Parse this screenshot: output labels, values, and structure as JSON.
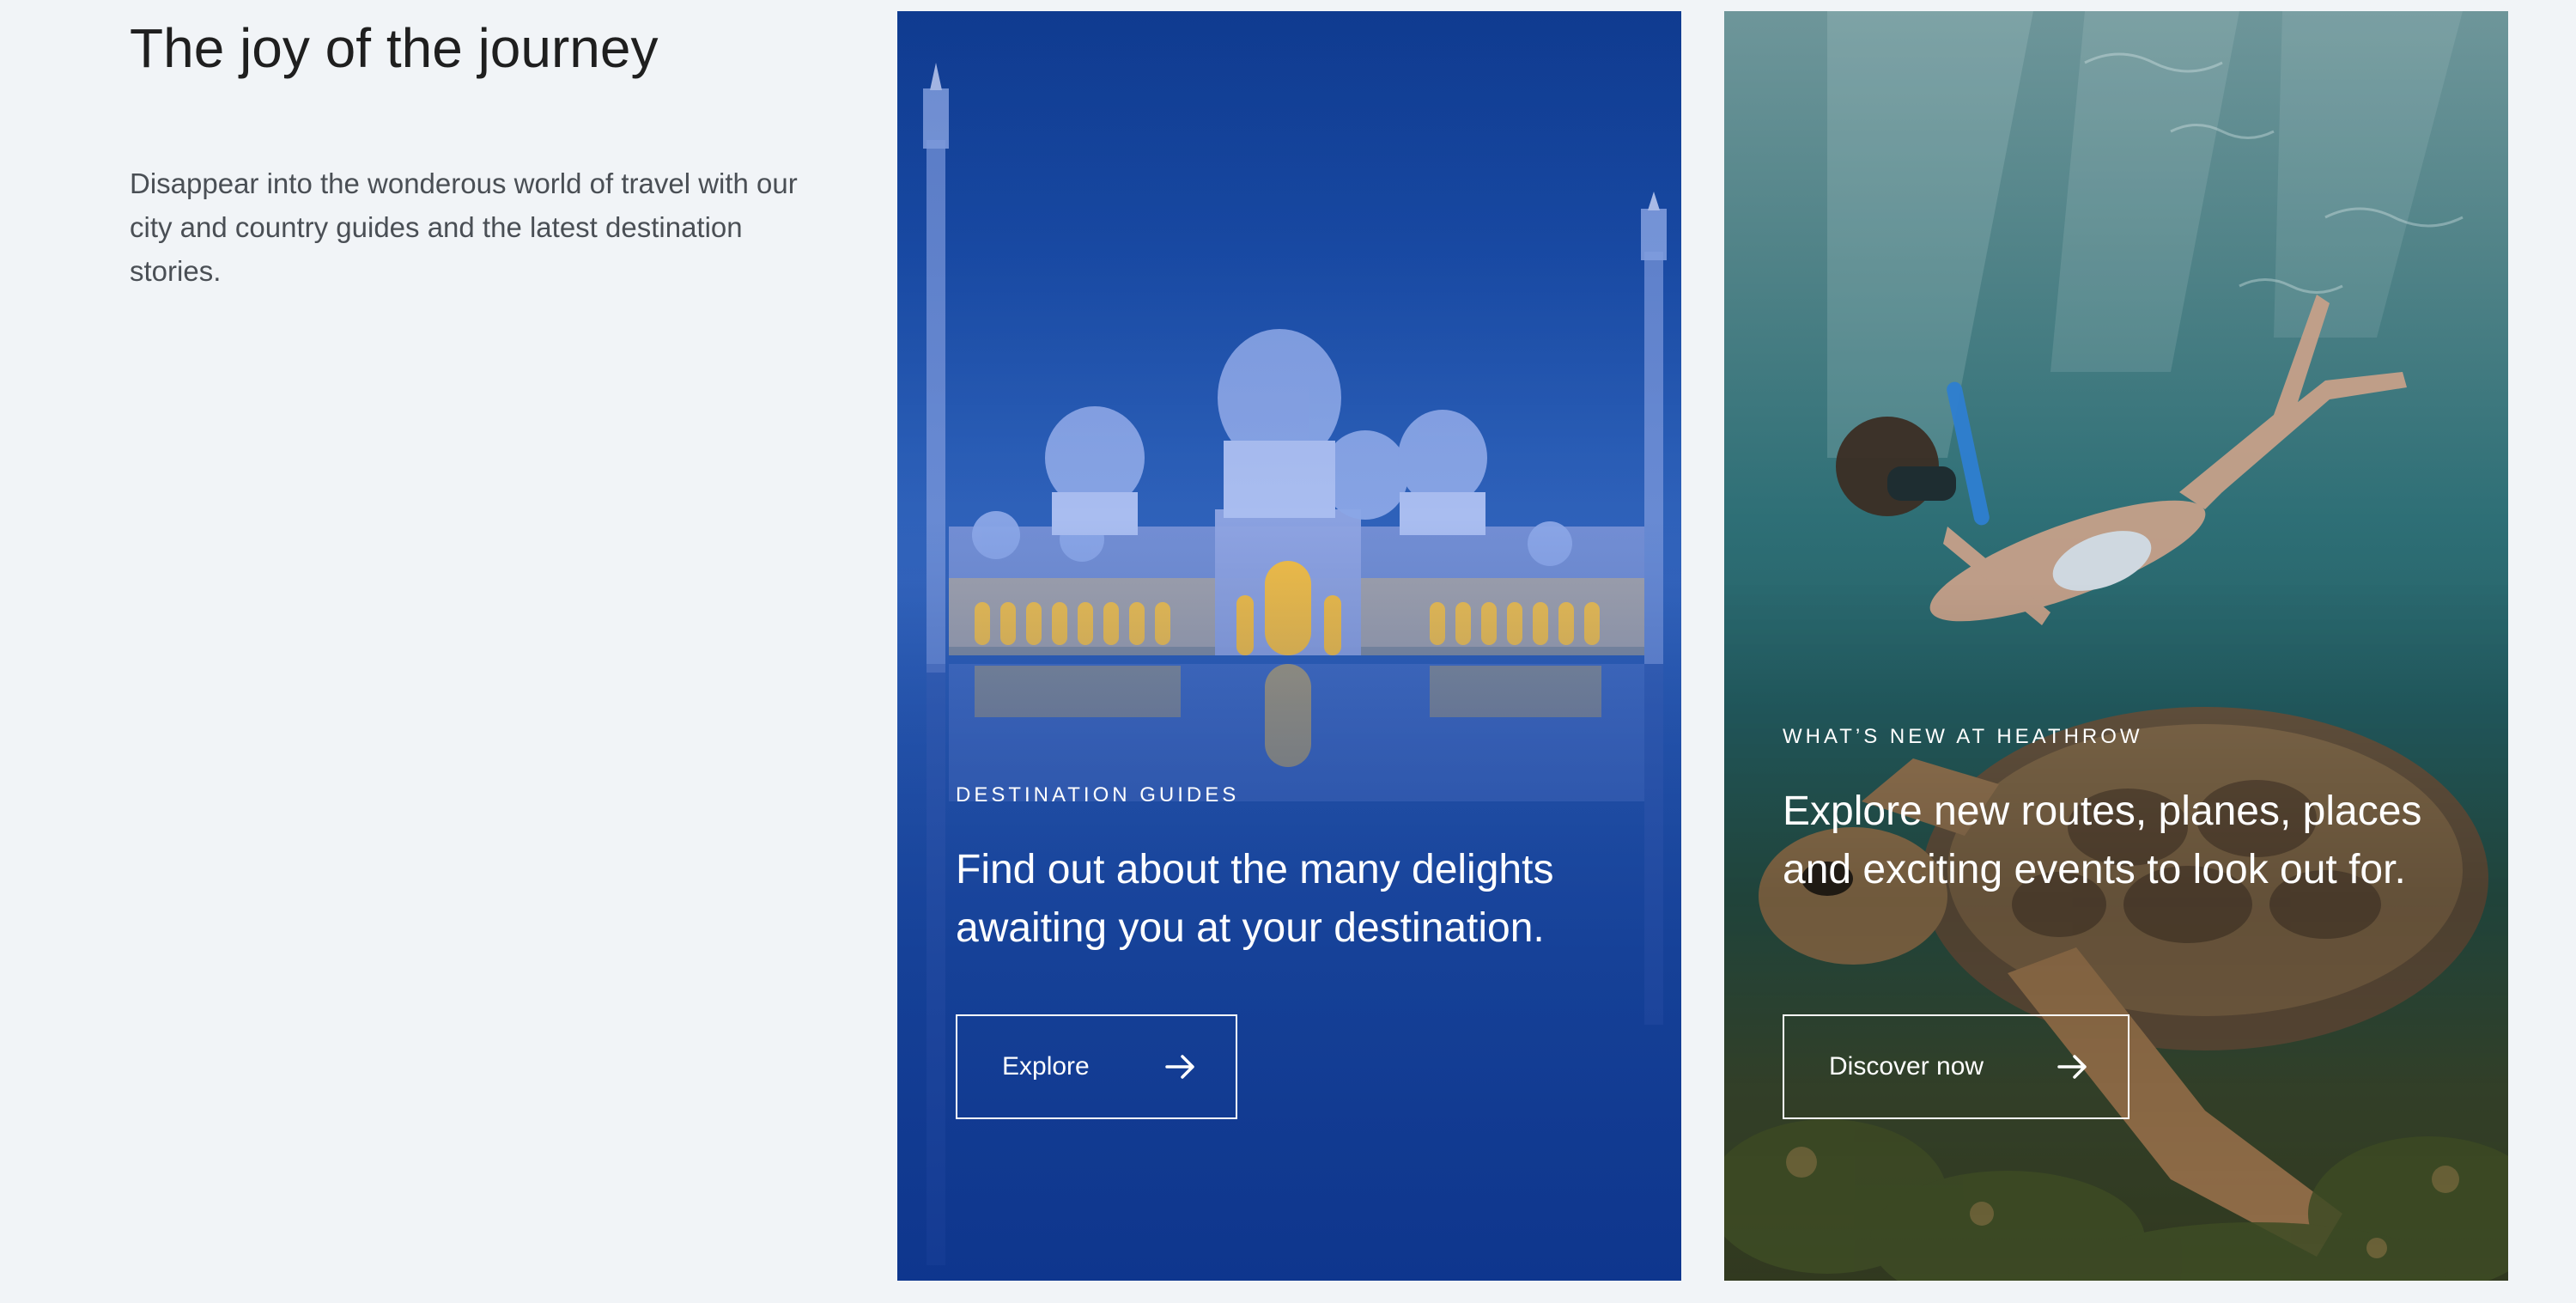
{
  "intro": {
    "title": "The joy of the journey",
    "description": "Disappear into the wonderous world of travel with our city and country guides and the latest destination stories."
  },
  "cards": [
    {
      "eyebrow": "DESTINATION GUIDES",
      "headline": "Find out about the many delights awaiting you at your destination.",
      "cta_label": "Explore",
      "cta_icon": "arrow-right-icon",
      "image": "mosque-reflection-image"
    },
    {
      "eyebrow": "WHAT’S NEW AT HEATHROW",
      "headline": "Explore new routes, planes, places and exciting events to look out for.",
      "cta_label": "Discover now",
      "cta_icon": "arrow-right-icon",
      "image": "snorkeler-turtle-image"
    }
  ],
  "colors": {
    "page_background": "#f1f4f7",
    "title_text": "#1f1f1f",
    "body_text": "#4a4f55",
    "card_text": "#ffffff"
  }
}
